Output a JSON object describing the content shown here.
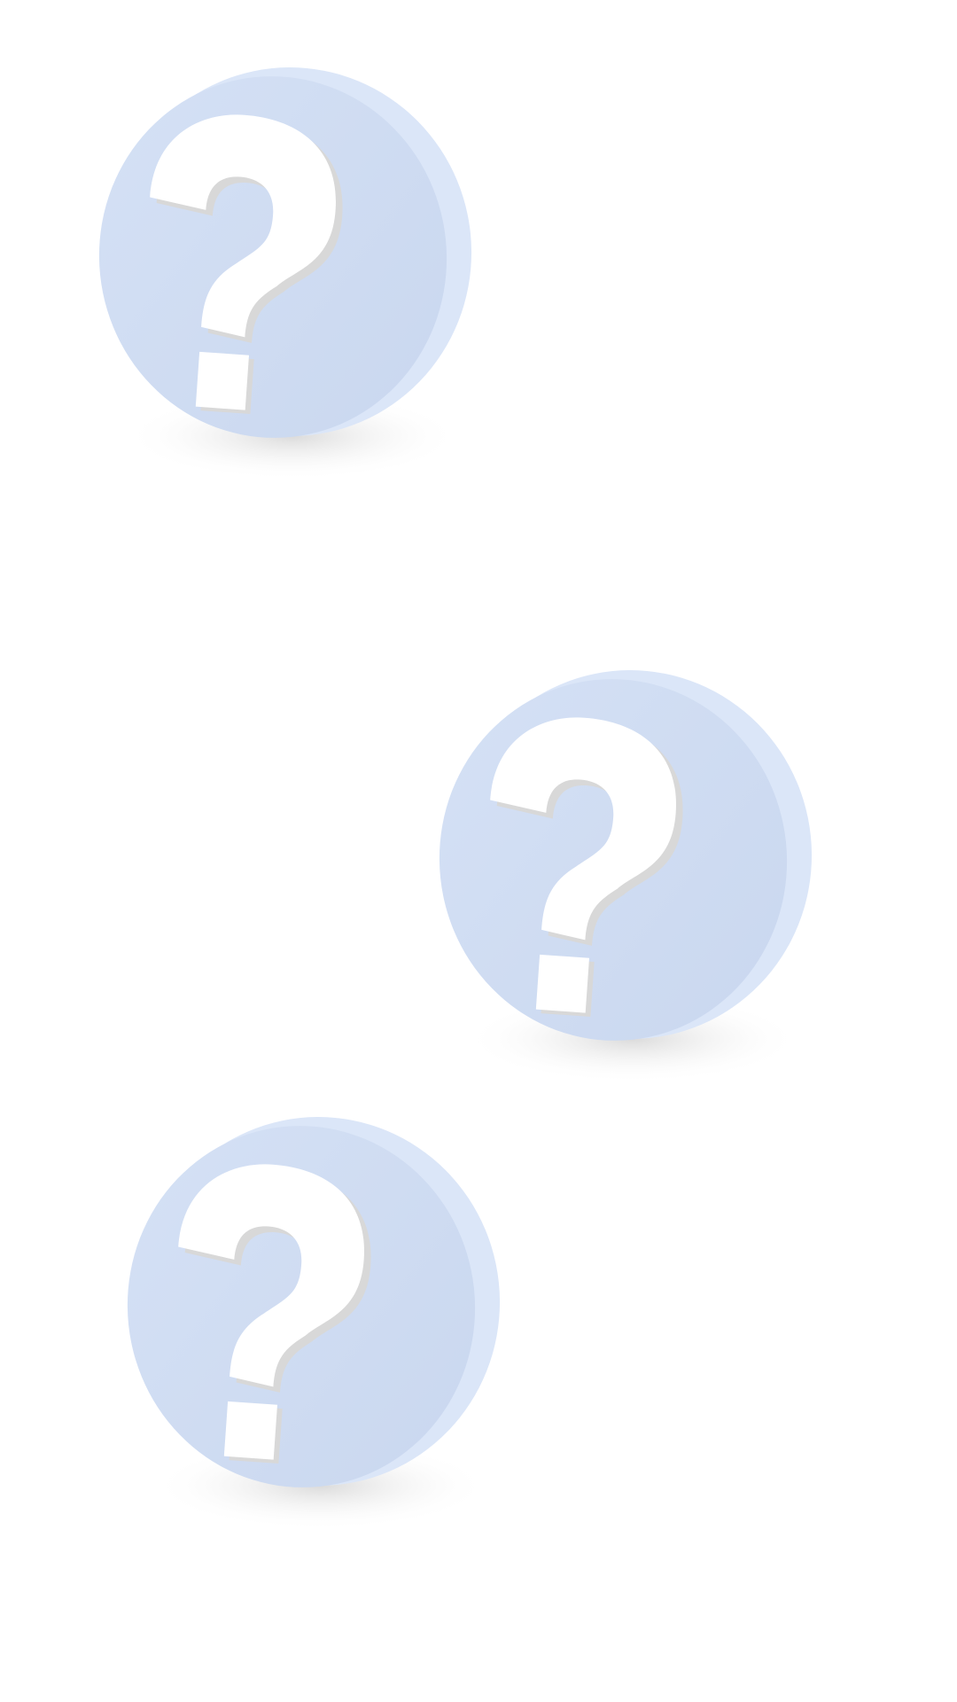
{
  "colors": {
    "background": "#ffffff",
    "disc_face": "#cfdcf1",
    "disc_rim": "#dbe6f8",
    "disc_highlight": "#e6eefb",
    "glyph": "#ffffff",
    "glyph_side": "#d8d8d8",
    "shadow": "#c8c8c8"
  },
  "badges": [
    {
      "icon": "question-mark-icon",
      "glyph": "?"
    },
    {
      "icon": "question-mark-icon",
      "glyph": "?"
    },
    {
      "icon": "question-mark-icon",
      "glyph": "?"
    }
  ]
}
